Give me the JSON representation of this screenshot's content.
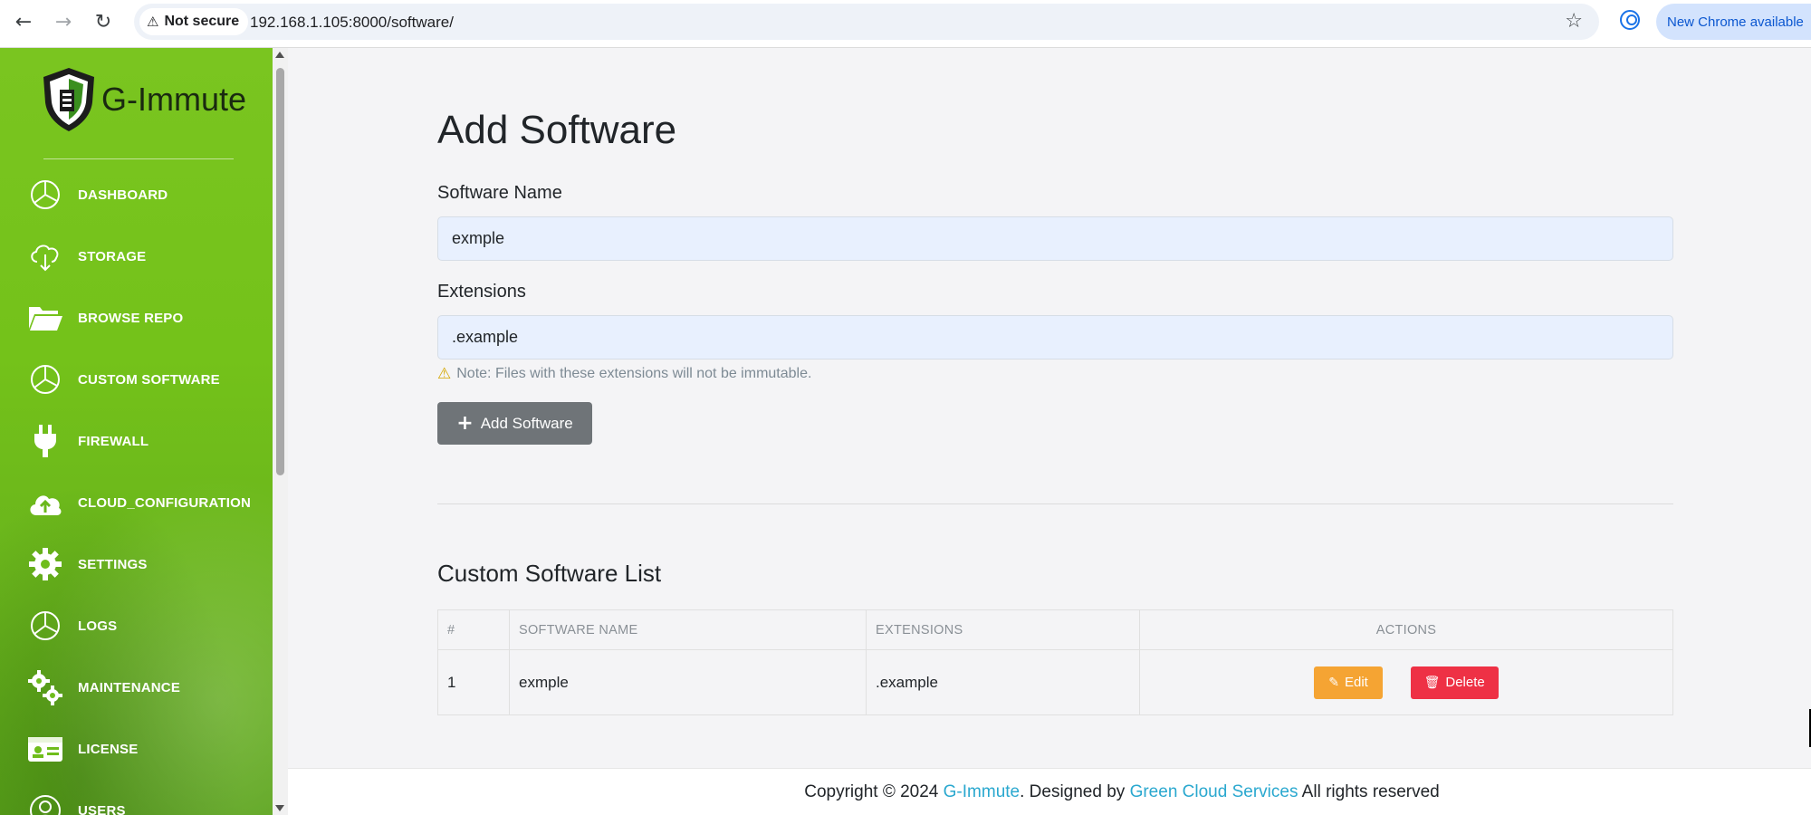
{
  "browser": {
    "security_label": "Not secure",
    "url": "192.168.1.105:8000/software/",
    "update_label": "New Chrome available",
    "icons": [
      "back-icon",
      "forward-icon",
      "reload-icon",
      "warning-icon",
      "star-icon",
      "profile-icon"
    ]
  },
  "sidebar": {
    "logo_text": "G-Immute",
    "items": [
      {
        "label": "DASHBOARD",
        "icon": "pie-chart-icon"
      },
      {
        "label": "STORAGE",
        "icon": "cloud-download-icon"
      },
      {
        "label": "BROWSE REPO",
        "icon": "folder-open-icon"
      },
      {
        "label": "CUSTOM SOFTWARE",
        "icon": "pie-chart-icon"
      },
      {
        "label": "FIREWALL",
        "icon": "plug-icon"
      },
      {
        "label": "CLOUD_CONFIGURATION",
        "icon": "cloud-upload-icon"
      },
      {
        "label": "SETTINGS",
        "icon": "gear-icon"
      },
      {
        "label": "LOGS",
        "icon": "pie-chart-icon"
      },
      {
        "label": "MAINTENANCE",
        "icon": "gears-icon"
      },
      {
        "label": "LICENSE",
        "icon": "id-card-icon"
      },
      {
        "label": "USERS",
        "icon": "user-icon"
      }
    ]
  },
  "form": {
    "title": "Add Software",
    "name_label": "Software Name",
    "name_value": "exmple",
    "ext_label": "Extensions",
    "ext_value": ".example",
    "note": "Note: Files with these extensions will not be immutable.",
    "submit_label": "Add Software"
  },
  "list": {
    "title": "Custom Software List",
    "columns": [
      "#",
      "SOFTWARE NAME",
      "EXTENSIONS",
      "ACTIONS"
    ],
    "rows": [
      {
        "index": "1",
        "name": "exmple",
        "extensions": ".example",
        "edit_label": "Edit",
        "delete_label": "Delete"
      }
    ]
  },
  "footer": {
    "prefix": "Copyright © 2024 ",
    "brand": "G-Immute",
    "middle": ". Designed by ",
    "company": "Green Cloud Services",
    "suffix": " All rights reserved"
  },
  "colors": {
    "sidebar_green": "#74c21a",
    "edit": "#f5a433",
    "delete": "#ee3145",
    "link": "#2aa8cf",
    "add_button": "#6f7478"
  }
}
